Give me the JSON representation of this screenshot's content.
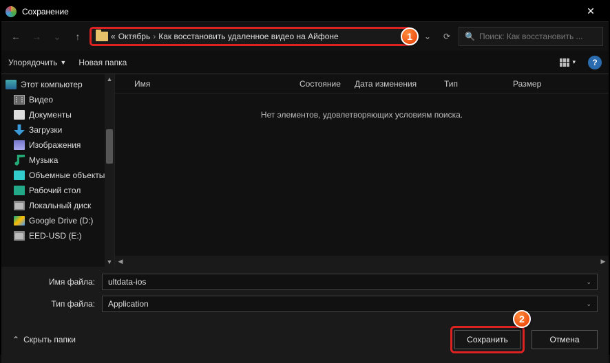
{
  "title": "Сохранение",
  "nav": {
    "back": "←",
    "fwd": "→",
    "up": "↑",
    "recent": "⌄"
  },
  "address": {
    "prefix": "«",
    "crumbs": [
      "Октябрь",
      "Как восстановить удаленное видео на Айфоне"
    ],
    "sep": "›"
  },
  "actions": {
    "dropdown": "⌄",
    "refresh": "⟳"
  },
  "search": {
    "icon": "🔍",
    "placeholder": "Поиск: Как восстановить ..."
  },
  "toolbar": {
    "organize": "Упорядочить",
    "newFolder": "Новая папка",
    "view_dd": "▾",
    "help": "?"
  },
  "columns": {
    "name": "Имя",
    "state": "Состояние",
    "date": "Дата изменения",
    "type": "Тип",
    "size": "Размер"
  },
  "tree": {
    "root": "Этот компьютер",
    "items": [
      {
        "label": "Видео",
        "ic": "ic-vid"
      },
      {
        "label": "Документы",
        "ic": "ic-doc"
      },
      {
        "label": "Загрузки",
        "ic": "ic-dl"
      },
      {
        "label": "Изображения",
        "ic": "ic-img"
      },
      {
        "label": "Музыка",
        "ic": "ic-mus"
      },
      {
        "label": "Объемные объекты",
        "ic": "ic-3d"
      },
      {
        "label": "Рабочий стол",
        "ic": "ic-desk"
      },
      {
        "label": "Локальный диск",
        "ic": "ic-disk"
      },
      {
        "label": "Google Drive (D:)",
        "ic": "ic-gd"
      },
      {
        "label": "EED-USD (E:)",
        "ic": "ic-disk"
      }
    ]
  },
  "empty": "Нет элементов, удовлетворяющих условиям поиска.",
  "fields": {
    "nameLabel": "Имя файла:",
    "nameValue": "ultdata-ios",
    "typeLabel": "Тип файла:",
    "typeValue": "Application"
  },
  "footer": {
    "hide": "Скрыть папки",
    "caret": "⌃",
    "save": "Сохранить",
    "cancel": "Отмена"
  },
  "markers": {
    "one": "1",
    "two": "2"
  }
}
